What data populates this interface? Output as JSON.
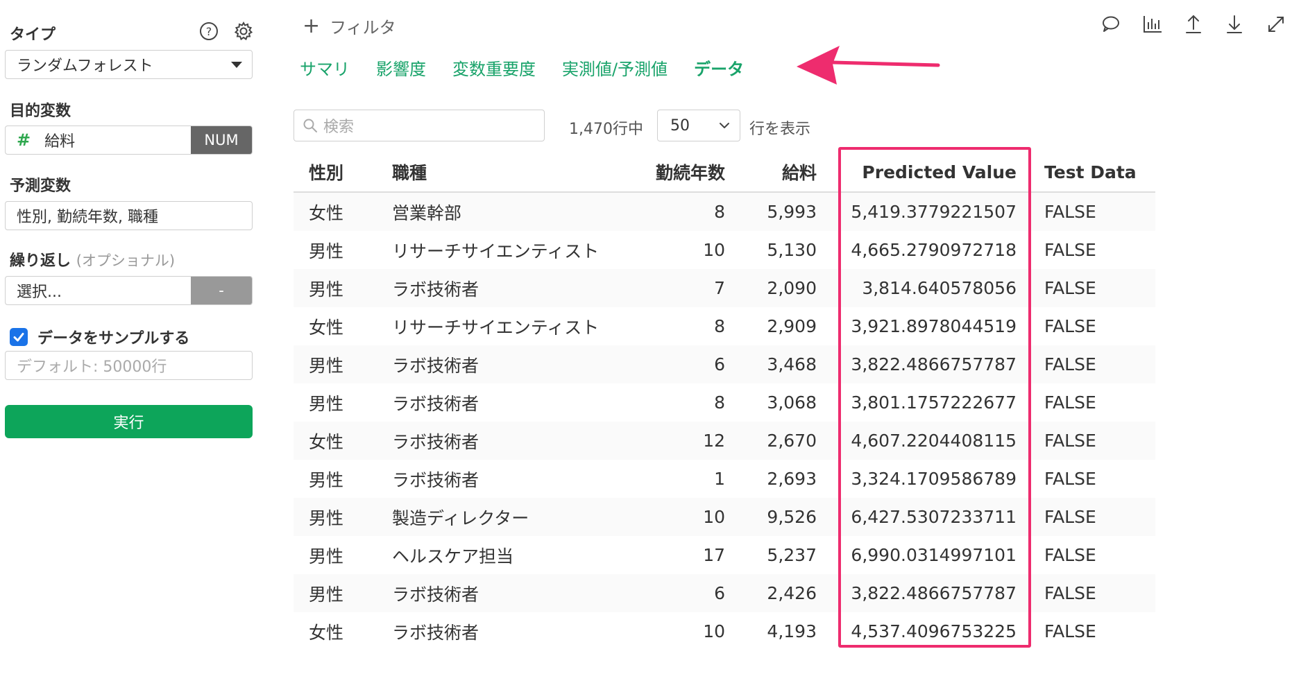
{
  "sidebar": {
    "type_label": "タイプ",
    "type_value": "ランダムフォレスト",
    "target_label": "目的変数",
    "target_hash": "#",
    "target_value": "給料",
    "target_badge": "NUM",
    "predictor_label": "予測変数",
    "predictor_value": "性別, 勤続年数, 職種",
    "repeat_label": "繰り返し",
    "repeat_optional": "(オプショナル)",
    "repeat_value": "選択...",
    "repeat_button": "-",
    "sample_label": "データをサンプルする",
    "sample_checked": true,
    "sample_placeholder": "デフォルト: 50000行",
    "run_button": "実行"
  },
  "toolbar": {
    "filter_plus": "+",
    "filter_label": "フィルタ",
    "icons": [
      "comment-icon",
      "chart-icon",
      "upload-icon",
      "download-icon",
      "expand-icon"
    ]
  },
  "tabs": [
    {
      "label": "サマリ",
      "active": false
    },
    {
      "label": "影響度",
      "active": false
    },
    {
      "label": "変数重要度",
      "active": false
    },
    {
      "label": "実測値/予測値",
      "active": false
    },
    {
      "label": "データ",
      "active": true
    }
  ],
  "controls": {
    "search_placeholder": "検索",
    "row_count": "1,470行中",
    "page_size": "50",
    "rows_label": "行を表示"
  },
  "table": {
    "headers": [
      "性別",
      "職種",
      "勤続年数",
      "給料",
      "Predicted Value",
      "Test Data"
    ],
    "rows": [
      [
        "女性",
        "営業幹部",
        "8",
        "5,993",
        "5,419.3779221507",
        "FALSE"
      ],
      [
        "男性",
        "リサーチサイエンティスト",
        "10",
        "5,130",
        "4,665.2790972718",
        "FALSE"
      ],
      [
        "男性",
        "ラボ技術者",
        "7",
        "2,090",
        "3,814.640578056",
        "FALSE"
      ],
      [
        "女性",
        "リサーチサイエンティスト",
        "8",
        "2,909",
        "3,921.8978044519",
        "FALSE"
      ],
      [
        "男性",
        "ラボ技術者",
        "6",
        "3,468",
        "3,822.4866757787",
        "FALSE"
      ],
      [
        "男性",
        "ラボ技術者",
        "8",
        "3,068",
        "3,801.1757222677",
        "FALSE"
      ],
      [
        "女性",
        "ラボ技術者",
        "12",
        "2,670",
        "4,607.2204408115",
        "FALSE"
      ],
      [
        "男性",
        "ラボ技術者",
        "1",
        "2,693",
        "3,324.1709586789",
        "FALSE"
      ],
      [
        "男性",
        "製造ディレクター",
        "10",
        "9,526",
        "6,427.5307233711",
        "FALSE"
      ],
      [
        "男性",
        "ヘルスケア担当",
        "17",
        "5,237",
        "6,990.0314997101",
        "FALSE"
      ],
      [
        "男性",
        "ラボ技術者",
        "6",
        "2,426",
        "3,822.4866757787",
        "FALSE"
      ],
      [
        "女性",
        "ラボ技術者",
        "10",
        "4,193",
        "4,537.4096753225",
        "FALSE"
      ]
    ]
  },
  "colors": {
    "accent_green": "#19a36a",
    "run_button": "#0da55a",
    "highlight": "#ee2c6e",
    "checkbox": "#1a73e8"
  }
}
